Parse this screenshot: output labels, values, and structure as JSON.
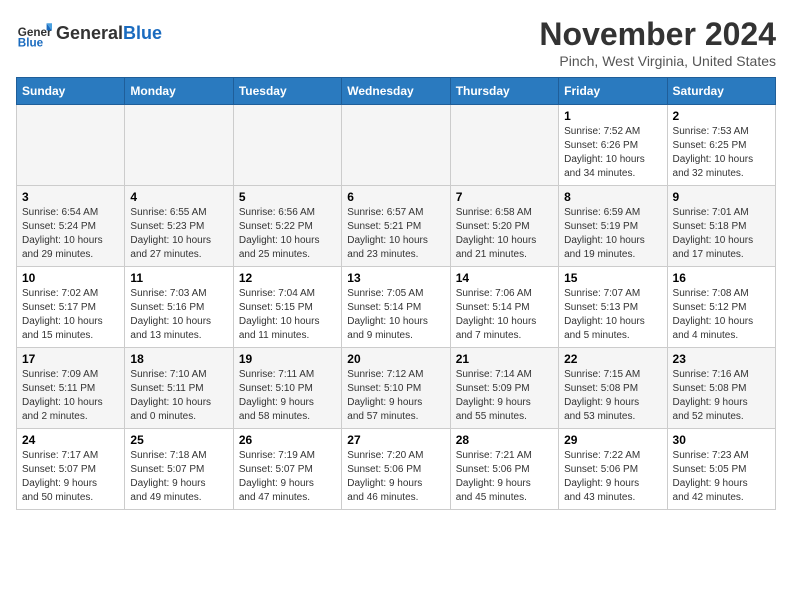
{
  "header": {
    "logo_general": "General",
    "logo_blue": "Blue",
    "month_title": "November 2024",
    "location": "Pinch, West Virginia, United States"
  },
  "weekdays": [
    "Sunday",
    "Monday",
    "Tuesday",
    "Wednesday",
    "Thursday",
    "Friday",
    "Saturday"
  ],
  "weeks": [
    [
      {
        "day": "",
        "info": "",
        "empty": true
      },
      {
        "day": "",
        "info": "",
        "empty": true
      },
      {
        "day": "",
        "info": "",
        "empty": true
      },
      {
        "day": "",
        "info": "",
        "empty": true
      },
      {
        "day": "",
        "info": "",
        "empty": true
      },
      {
        "day": "1",
        "info": "Sunrise: 7:52 AM\nSunset: 6:26 PM\nDaylight: 10 hours\nand 34 minutes."
      },
      {
        "day": "2",
        "info": "Sunrise: 7:53 AM\nSunset: 6:25 PM\nDaylight: 10 hours\nand 32 minutes."
      }
    ],
    [
      {
        "day": "3",
        "info": "Sunrise: 6:54 AM\nSunset: 5:24 PM\nDaylight: 10 hours\nand 29 minutes."
      },
      {
        "day": "4",
        "info": "Sunrise: 6:55 AM\nSunset: 5:23 PM\nDaylight: 10 hours\nand 27 minutes."
      },
      {
        "day": "5",
        "info": "Sunrise: 6:56 AM\nSunset: 5:22 PM\nDaylight: 10 hours\nand 25 minutes."
      },
      {
        "day": "6",
        "info": "Sunrise: 6:57 AM\nSunset: 5:21 PM\nDaylight: 10 hours\nand 23 minutes."
      },
      {
        "day": "7",
        "info": "Sunrise: 6:58 AM\nSunset: 5:20 PM\nDaylight: 10 hours\nand 21 minutes."
      },
      {
        "day": "8",
        "info": "Sunrise: 6:59 AM\nSunset: 5:19 PM\nDaylight: 10 hours\nand 19 minutes."
      },
      {
        "day": "9",
        "info": "Sunrise: 7:01 AM\nSunset: 5:18 PM\nDaylight: 10 hours\nand 17 minutes."
      }
    ],
    [
      {
        "day": "10",
        "info": "Sunrise: 7:02 AM\nSunset: 5:17 PM\nDaylight: 10 hours\nand 15 minutes."
      },
      {
        "day": "11",
        "info": "Sunrise: 7:03 AM\nSunset: 5:16 PM\nDaylight: 10 hours\nand 13 minutes."
      },
      {
        "day": "12",
        "info": "Sunrise: 7:04 AM\nSunset: 5:15 PM\nDaylight: 10 hours\nand 11 minutes."
      },
      {
        "day": "13",
        "info": "Sunrise: 7:05 AM\nSunset: 5:14 PM\nDaylight: 10 hours\nand 9 minutes."
      },
      {
        "day": "14",
        "info": "Sunrise: 7:06 AM\nSunset: 5:14 PM\nDaylight: 10 hours\nand 7 minutes."
      },
      {
        "day": "15",
        "info": "Sunrise: 7:07 AM\nSunset: 5:13 PM\nDaylight: 10 hours\nand 5 minutes."
      },
      {
        "day": "16",
        "info": "Sunrise: 7:08 AM\nSunset: 5:12 PM\nDaylight: 10 hours\nand 4 minutes."
      }
    ],
    [
      {
        "day": "17",
        "info": "Sunrise: 7:09 AM\nSunset: 5:11 PM\nDaylight: 10 hours\nand 2 minutes."
      },
      {
        "day": "18",
        "info": "Sunrise: 7:10 AM\nSunset: 5:11 PM\nDaylight: 10 hours\nand 0 minutes."
      },
      {
        "day": "19",
        "info": "Sunrise: 7:11 AM\nSunset: 5:10 PM\nDaylight: 9 hours\nand 58 minutes."
      },
      {
        "day": "20",
        "info": "Sunrise: 7:12 AM\nSunset: 5:10 PM\nDaylight: 9 hours\nand 57 minutes."
      },
      {
        "day": "21",
        "info": "Sunrise: 7:14 AM\nSunset: 5:09 PM\nDaylight: 9 hours\nand 55 minutes."
      },
      {
        "day": "22",
        "info": "Sunrise: 7:15 AM\nSunset: 5:08 PM\nDaylight: 9 hours\nand 53 minutes."
      },
      {
        "day": "23",
        "info": "Sunrise: 7:16 AM\nSunset: 5:08 PM\nDaylight: 9 hours\nand 52 minutes."
      }
    ],
    [
      {
        "day": "24",
        "info": "Sunrise: 7:17 AM\nSunset: 5:07 PM\nDaylight: 9 hours\nand 50 minutes."
      },
      {
        "day": "25",
        "info": "Sunrise: 7:18 AM\nSunset: 5:07 PM\nDaylight: 9 hours\nand 49 minutes."
      },
      {
        "day": "26",
        "info": "Sunrise: 7:19 AM\nSunset: 5:07 PM\nDaylight: 9 hours\nand 47 minutes."
      },
      {
        "day": "27",
        "info": "Sunrise: 7:20 AM\nSunset: 5:06 PM\nDaylight: 9 hours\nand 46 minutes."
      },
      {
        "day": "28",
        "info": "Sunrise: 7:21 AM\nSunset: 5:06 PM\nDaylight: 9 hours\nand 45 minutes."
      },
      {
        "day": "29",
        "info": "Sunrise: 7:22 AM\nSunset: 5:06 PM\nDaylight: 9 hours\nand 43 minutes."
      },
      {
        "day": "30",
        "info": "Sunrise: 7:23 AM\nSunset: 5:05 PM\nDaylight: 9 hours\nand 42 minutes."
      }
    ]
  ]
}
